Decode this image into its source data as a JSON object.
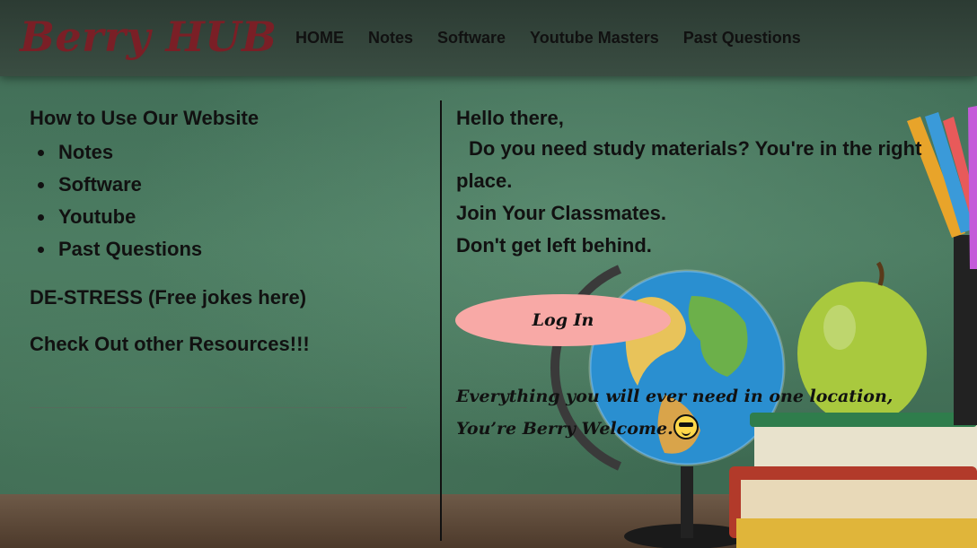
{
  "header": {
    "logo": "Berry HUB",
    "nav": [
      "HOME",
      "Notes",
      "Software",
      "Youtube Masters",
      "Past Questions"
    ]
  },
  "left": {
    "heading": "How to Use Our Website",
    "items": [
      "Notes",
      "Software",
      "Youtube",
      "Past Questions"
    ],
    "destress": "DE-STRESS (Free jokes here)",
    "resources": "Check Out other Resources!!!"
  },
  "right": {
    "greeting": "Hello there,",
    "question_line1": "Do you need study materials? You're in the right",
    "question_line2": "place.",
    "join": "Join Your Classmates.",
    "warning": "Don't get left behind.",
    "login_label": "Log In",
    "tagline1": "Everything you will ever need in one location,",
    "tagline2": "You’re Berry Welcome.",
    "emoji_icon": "smiling-face-with-sunglasses-icon"
  },
  "colors": {
    "logo": "#7a1f26",
    "login_button": "#f8a9a6",
    "header_bg": "#2c3b33",
    "chalkboard": "#3e6a52"
  }
}
